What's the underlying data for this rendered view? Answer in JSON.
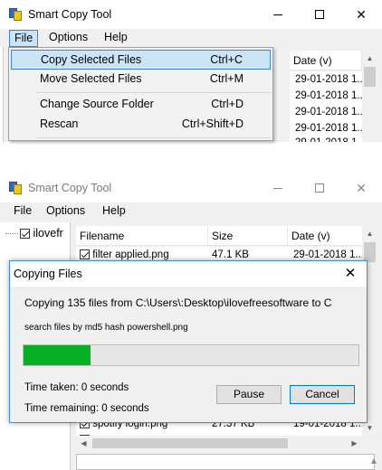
{
  "colors": {
    "accent": "#0078d7",
    "menu_highlight": "#cce4f7",
    "progress_fill": "#06b025"
  },
  "window_top": {
    "title": "Smart Copy Tool",
    "menu": [
      "File",
      "Options",
      "Help"
    ],
    "date_header": "Date (v)",
    "dates": [
      "29-01-2018 1...",
      "29-01-2018 1...",
      "29-01-2018 1...",
      "29-01-2018 1...",
      "29-01-2018 1..."
    ],
    "dropdown": [
      {
        "label": "Copy Selected Files",
        "shortcut": "Ctrl+C"
      },
      {
        "label": "Move Selected Files",
        "shortcut": "Ctrl+M"
      },
      {
        "label": "Change Source Folder",
        "shortcut": "Ctrl+D"
      },
      {
        "label": "Rescan",
        "shortcut": "Ctrl+Shift+D"
      }
    ]
  },
  "window_bottom": {
    "title": "Smart Copy Tool",
    "menu": [
      "File",
      "Options",
      "Help"
    ],
    "tree_item": "ilovefr",
    "columns": [
      "Filename",
      "Size",
      "Date (v)"
    ],
    "rows": [
      {
        "name": "filter applied.png",
        "size": "47.1 KB",
        "date": "29-01-2018 1..."
      },
      {
        "name": "spotify login.png",
        "size": "27.37 KB",
        "date": "19-01-2018 1..."
      }
    ]
  },
  "dialog": {
    "title": "Copying Files",
    "message": "Copying 135 files from C:\\Users\\:Desktop\\ilovefreesoftware to C",
    "current_file": "search files by md5 hash powershell.png",
    "progress_percent": 20,
    "time_taken": "Time taken: 0 seconds",
    "time_remaining": "Time remaining: 0 seconds",
    "pause_label": "Pause",
    "cancel_label": "Cancel"
  }
}
